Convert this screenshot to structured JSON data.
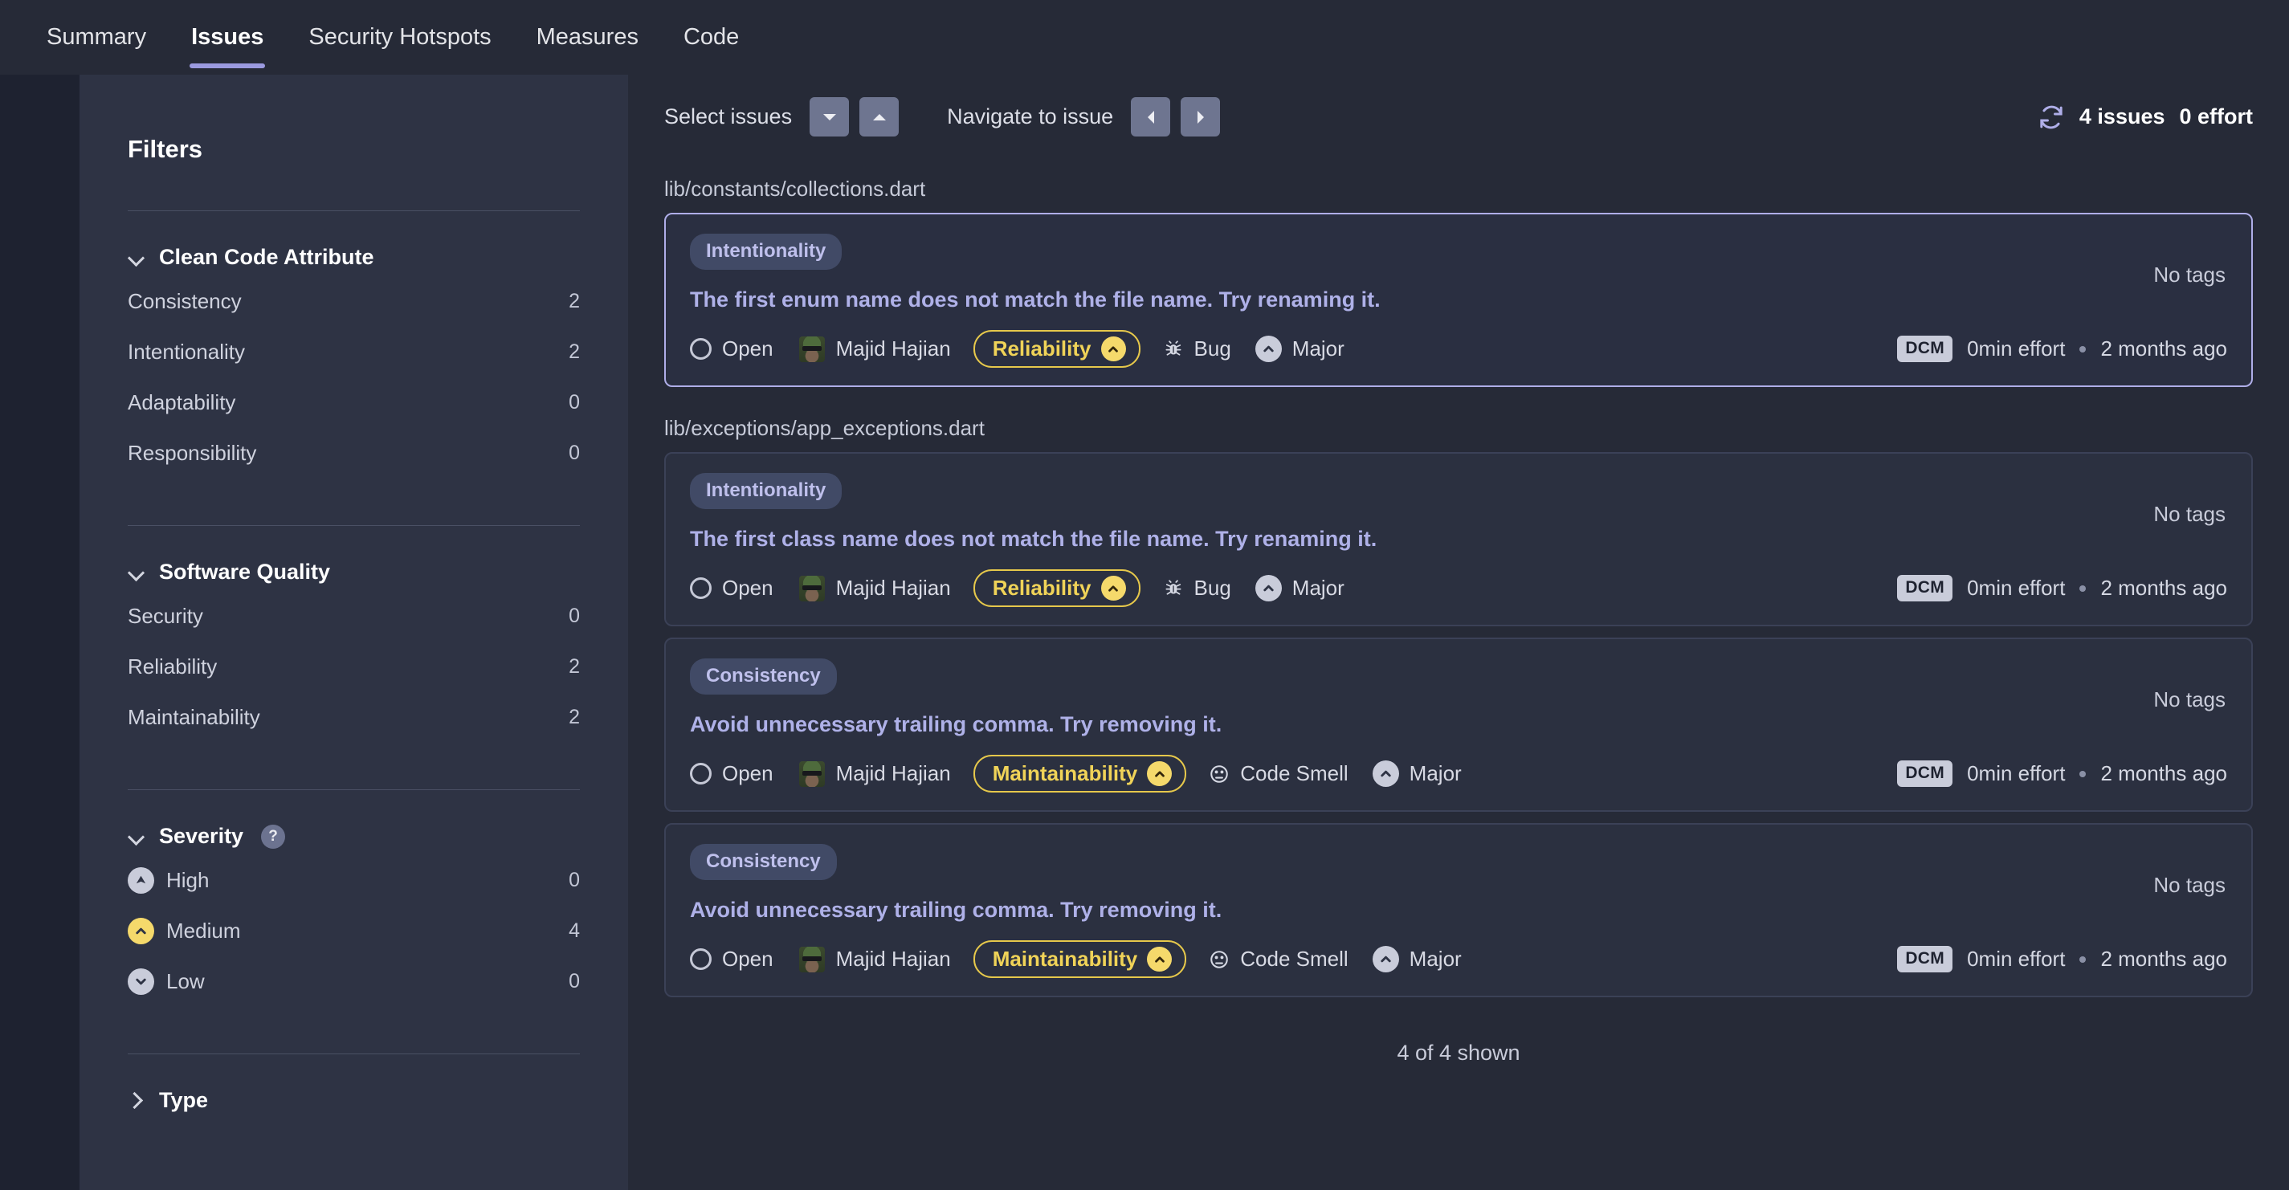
{
  "nav": {
    "tabs": [
      {
        "label": "Summary",
        "active": false
      },
      {
        "label": "Issues",
        "active": true
      },
      {
        "label": "Security Hotspots",
        "active": false
      },
      {
        "label": "Measures",
        "active": false
      },
      {
        "label": "Code",
        "active": false
      }
    ]
  },
  "sidebar": {
    "title": "Filters",
    "facets": [
      {
        "name": "Clean Code Attribute",
        "expanded": true,
        "items": [
          {
            "label": "Consistency",
            "count": "2"
          },
          {
            "label": "Intentionality",
            "count": "2"
          },
          {
            "label": "Adaptability",
            "count": "0"
          },
          {
            "label": "Responsibility",
            "count": "0"
          }
        ]
      },
      {
        "name": "Software Quality",
        "expanded": true,
        "items": [
          {
            "label": "Security",
            "count": "0"
          },
          {
            "label": "Reliability",
            "count": "2"
          },
          {
            "label": "Maintainability",
            "count": "2"
          }
        ]
      },
      {
        "name": "Severity",
        "expanded": true,
        "help": "?",
        "items": [
          {
            "label": "High",
            "count": "0",
            "icon": "severity-high-icon"
          },
          {
            "label": "Medium",
            "count": "4",
            "icon": "severity-medium-icon"
          },
          {
            "label": "Low",
            "count": "0",
            "icon": "severity-low-icon"
          }
        ]
      },
      {
        "name": "Type",
        "expanded": false,
        "items": []
      }
    ]
  },
  "toolbar": {
    "select_issues_label": "Select issues",
    "navigate_label": "Navigate to issue",
    "refresh_icon": "refresh-icon",
    "issues_count": "4 issues",
    "effort_total": "0 effort"
  },
  "groups": [
    {
      "file_path": "lib/constants/collections.dart",
      "issues": [
        {
          "attribute": "Intentionality",
          "title": "The first enum name does not match the file name. Try renaming it.",
          "tags": "No tags",
          "status": "Open",
          "assignee": "Majid Hajian",
          "quality": "Reliability",
          "type": "Bug",
          "type_icon": "bug-icon",
          "severity": "Major",
          "source": "DCM",
          "effort": "0min effort",
          "updated": "2 months ago",
          "selected": true
        }
      ]
    },
    {
      "file_path": "lib/exceptions/app_exceptions.dart",
      "issues": [
        {
          "attribute": "Intentionality",
          "title": "The first class name does not match the file name. Try renaming it.",
          "tags": "No tags",
          "status": "Open",
          "assignee": "Majid Hajian",
          "quality": "Reliability",
          "type": "Bug",
          "type_icon": "bug-icon",
          "severity": "Major",
          "source": "DCM",
          "effort": "0min effort",
          "updated": "2 months ago",
          "selected": false
        },
        {
          "attribute": "Consistency",
          "title": "Avoid unnecessary trailing comma. Try removing it.",
          "tags": "No tags",
          "status": "Open",
          "assignee": "Majid Hajian",
          "quality": "Maintainability",
          "type": "Code Smell",
          "type_icon": "code-smell-icon",
          "severity": "Major",
          "source": "DCM",
          "effort": "0min effort",
          "updated": "2 months ago",
          "selected": false
        },
        {
          "attribute": "Consistency",
          "title": "Avoid unnecessary trailing comma. Try removing it.",
          "tags": "No tags",
          "status": "Open",
          "assignee": "Majid Hajian",
          "quality": "Maintainability",
          "type": "Code Smell",
          "type_icon": "code-smell-icon",
          "severity": "Major",
          "source": "DCM",
          "effort": "0min effort",
          "updated": "2 months ago",
          "selected": false
        }
      ]
    }
  ],
  "footer": {
    "shown": "4 of 4 shown"
  },
  "colors": {
    "accent": "#9B9ADF",
    "quality_pill": "#F0D358",
    "severity_medium": "#F5D96B",
    "card_bg": "#2B3040",
    "sidebar_bg": "#2E3344",
    "main_bg": "#262A37"
  }
}
